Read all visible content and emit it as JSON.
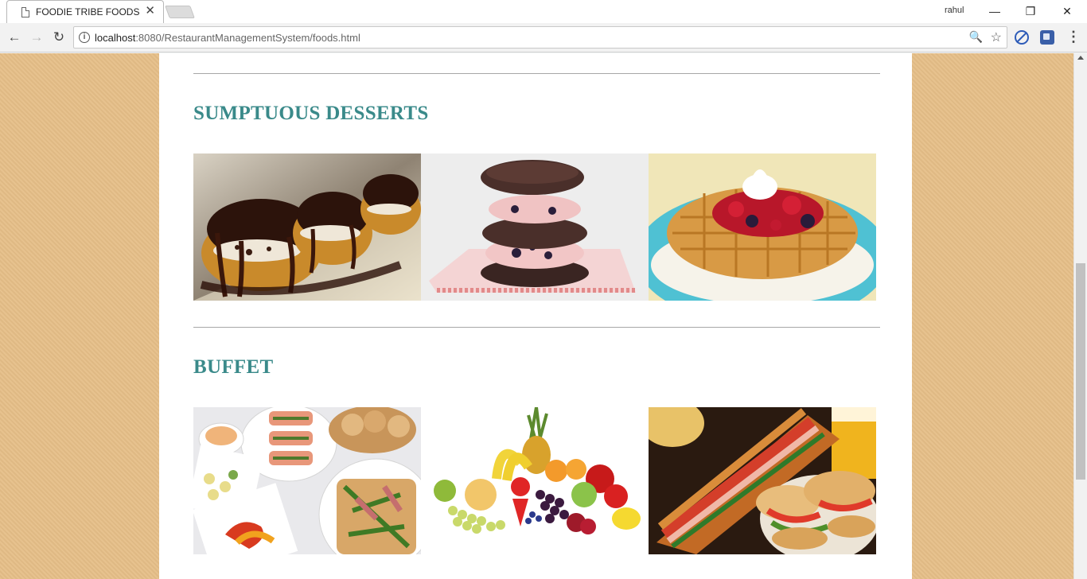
{
  "browser": {
    "tab_title": "FOODIE TRIBE FOODS",
    "tab_close": "✕",
    "profile_name": "rahul",
    "url_host": "localhost",
    "url_rest": ":8080/RestaurantManagementSystem/foods.html",
    "window_controls": {
      "minimize": "—",
      "restore": "❐",
      "close": "✕"
    },
    "nav": {
      "back": "←",
      "forward": "→",
      "reload": "↻",
      "menu": "⋮"
    },
    "omnibox_icons": {
      "info": "i",
      "zoom": "🔍",
      "star": "☆"
    }
  },
  "page": {
    "sections": [
      {
        "title": "SUMPTUOUS DESSERTS",
        "images": [
          "chocolate-profiteroles-image",
          "ice-cream-cookie-sandwich-image",
          "berry-waffle-image"
        ]
      },
      {
        "title": "BUFFET",
        "images": [
          "buffet-platter-image",
          "fruit-assortment-image",
          "sub-sandwich-image"
        ]
      }
    ]
  },
  "colors": {
    "page_background": "#e6bf88",
    "section_title": "#3a8a8a",
    "divider": "#a7a7a7"
  }
}
